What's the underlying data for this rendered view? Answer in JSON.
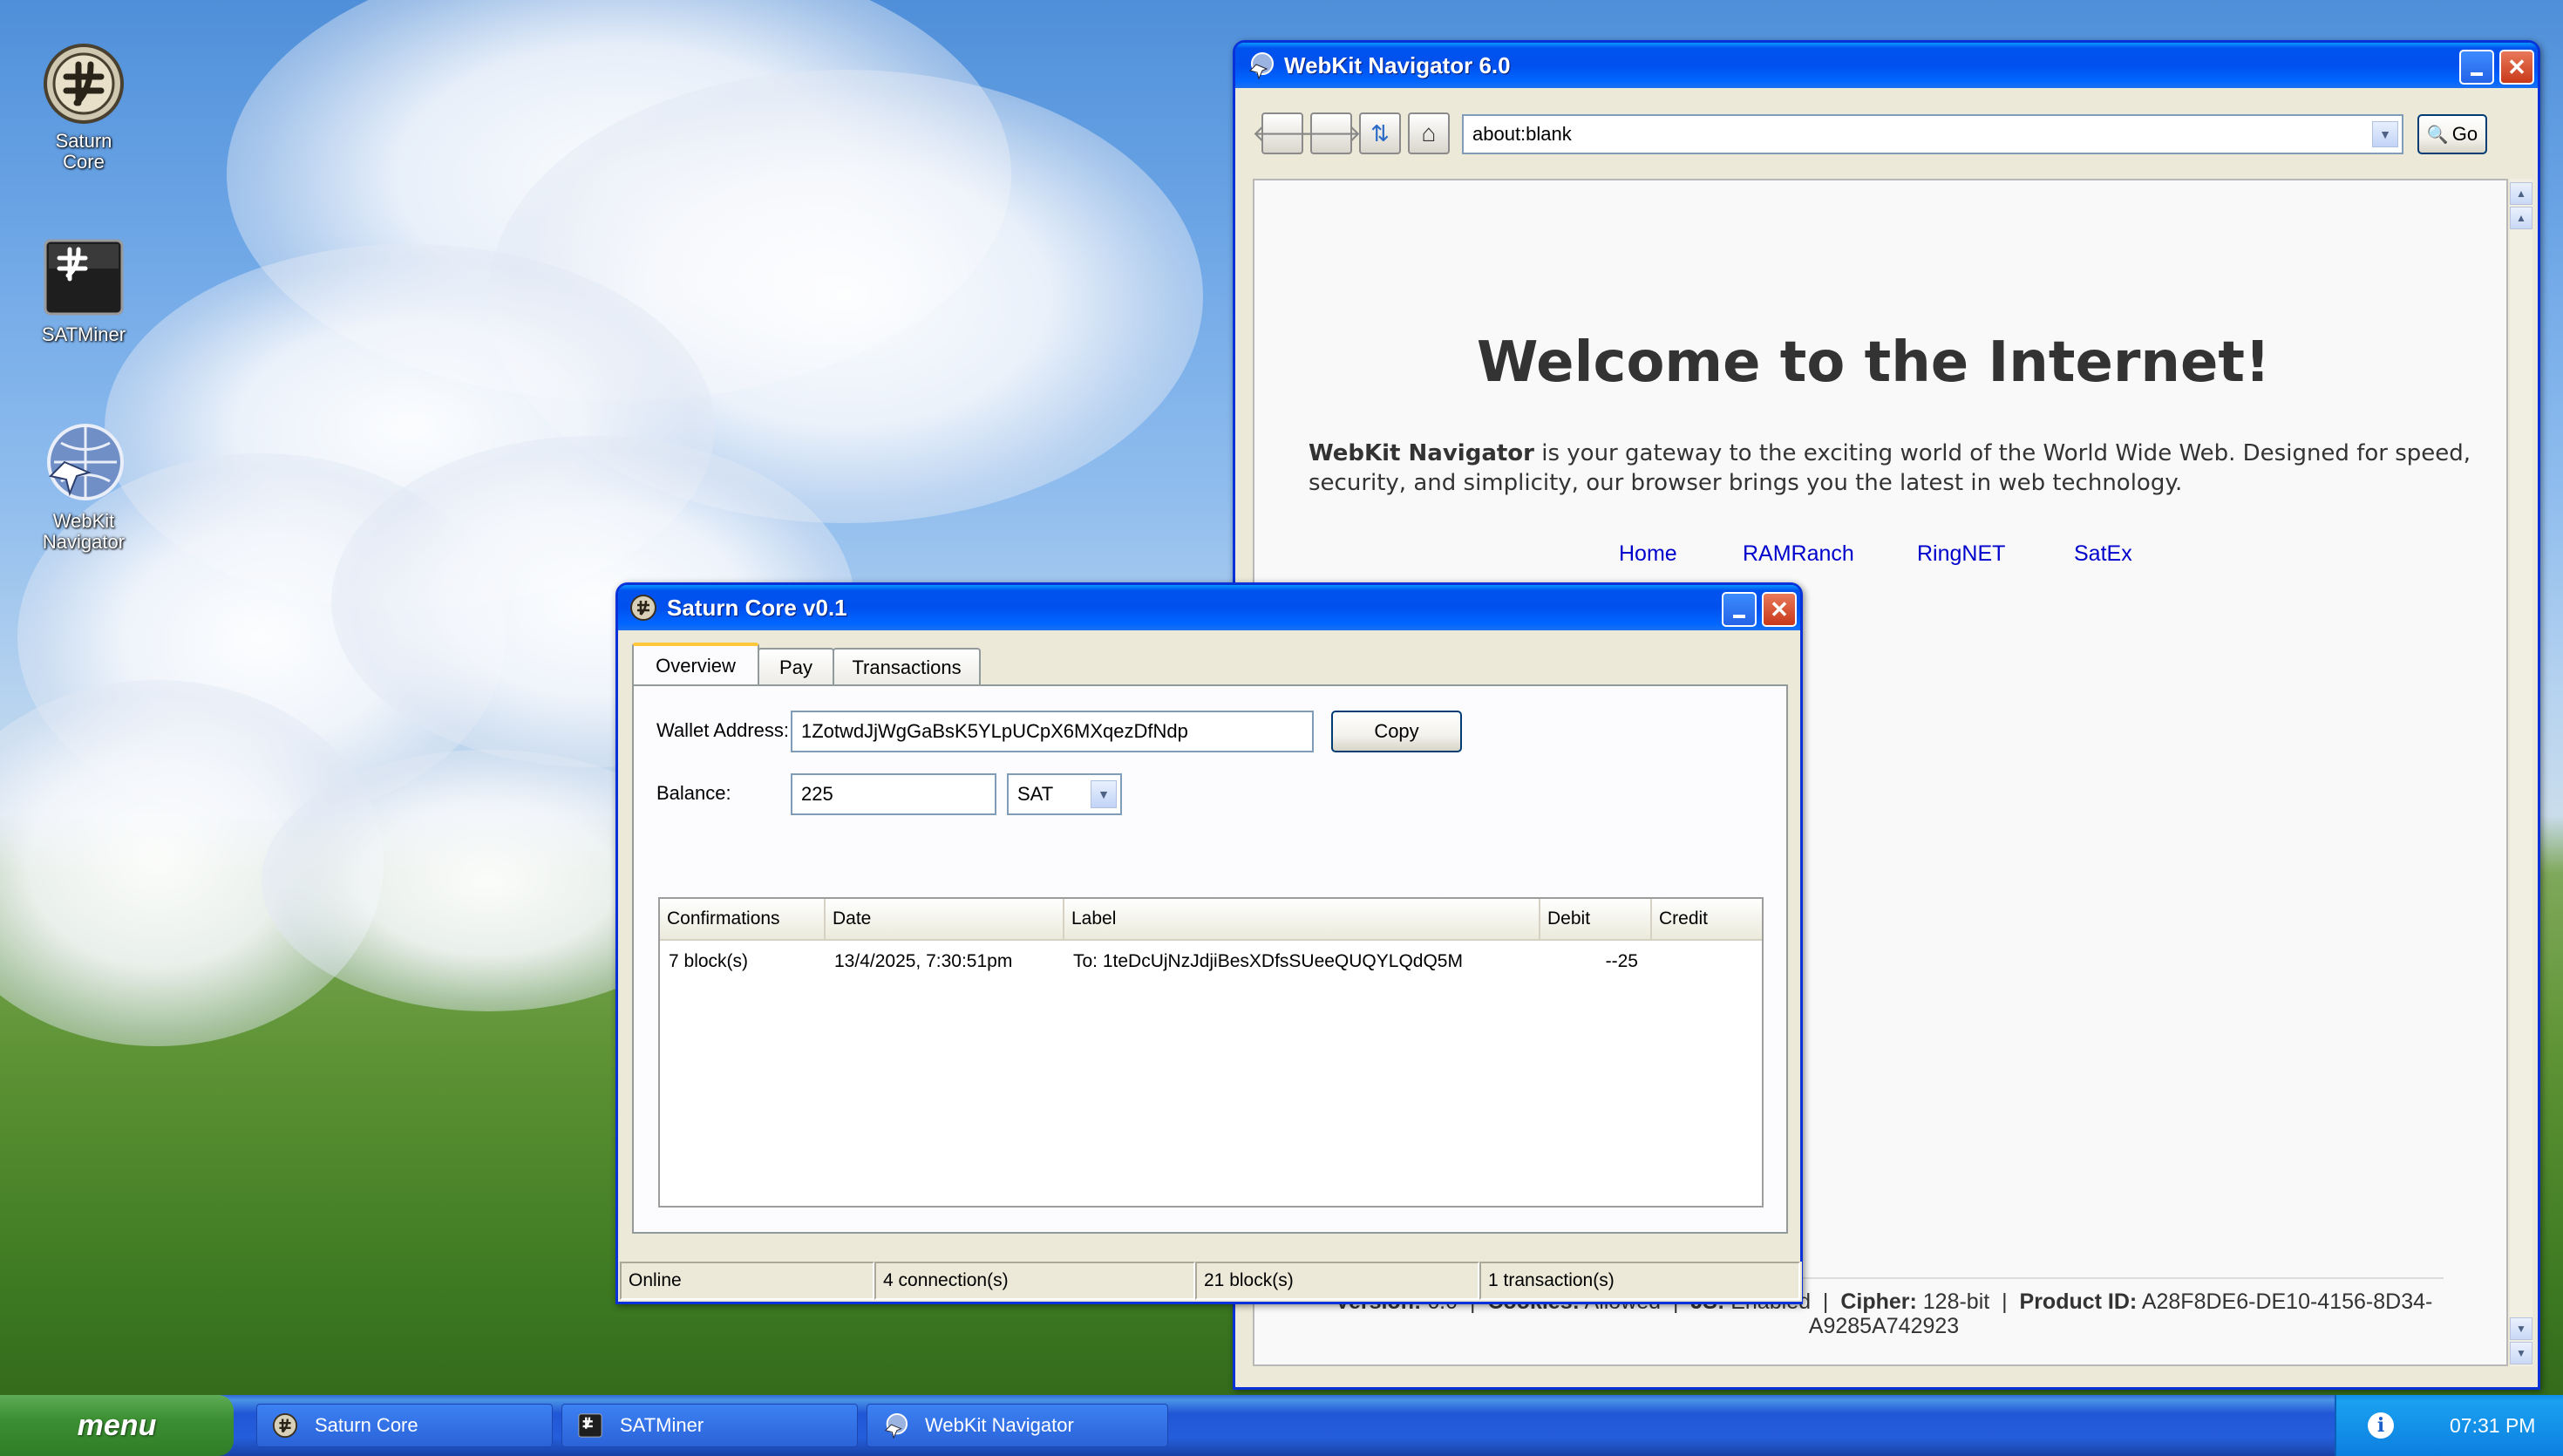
{
  "desktop": {
    "icons": [
      {
        "label_line1": "Saturn",
        "label_line2": "Core",
        "icon": "saturn-core-icon"
      },
      {
        "label_line1": "SATMiner",
        "label_line2": "",
        "icon": "satminer-icon"
      },
      {
        "label_line1": "WebKit",
        "label_line2": "Navigator",
        "icon": "webkit-navigator-icon"
      }
    ]
  },
  "browser": {
    "title": "WebKit Navigator 6.0",
    "address": "about:blank",
    "go_label": "Go",
    "heading": "Welcome to the Internet!",
    "intro_bold": "WebKit Navigator",
    "intro_rest_line1": " is your gateway to the exciting world of the World Wide Web. Designed for speed,",
    "intro_line2": "security, and simplicity, our browser brings you the latest in web technology.",
    "links": [
      "Home",
      "RAMRanch",
      "RingNET",
      "SatEx"
    ],
    "footer": {
      "version_label": "Version:",
      "version_value": "6.0",
      "cookies_label": "Cookies:",
      "cookies_value": "Allowed",
      "js_label": "JS:",
      "js_value": "Enabled",
      "cipher_label": "Cipher:",
      "cipher_value": "128-bit",
      "product_label": "Product ID:",
      "product_value_1": "A28F8DE6-DE10-4156-8D34-",
      "product_value_2": "A9285A742923",
      "separator": "|"
    }
  },
  "wallet": {
    "title": "Saturn Core v0.1",
    "tabs": [
      "Overview",
      "Pay",
      "Transactions"
    ],
    "active_tab": "Overview",
    "address_label": "Wallet Address:",
    "address_value": "1ZotwdJjWgGaBsK5YLpUCpX6MXqezDfNdp",
    "copy_label": "Copy",
    "balance_label": "Balance:",
    "balance_value": "225",
    "unit": "SAT",
    "table": {
      "columns": [
        "Confirmations",
        "Date",
        "Label",
        "Debit",
        "Credit"
      ],
      "rows": [
        {
          "confirmations": "7 block(s)",
          "date": "13/4/2025, 7:30:51pm",
          "label": "To: 1teDcUjNzJdjiBesXDfsSUeeQUQYLQdQ5M",
          "debit": "--25",
          "credit": ""
        }
      ]
    },
    "status": {
      "online": "Online",
      "connections": "4 connection(s)",
      "blocks": "21 block(s)",
      "transactions": "1 transaction(s)"
    }
  },
  "taskbar": {
    "start_label": "menu",
    "tasks": [
      "Saturn Core",
      "SATMiner",
      "WebKit Navigator"
    ],
    "clock": "07:31 PM",
    "colors": {
      "taskbar": "#245edb",
      "start": "#3c8f33",
      "titlebar": "#0050ee"
    }
  }
}
